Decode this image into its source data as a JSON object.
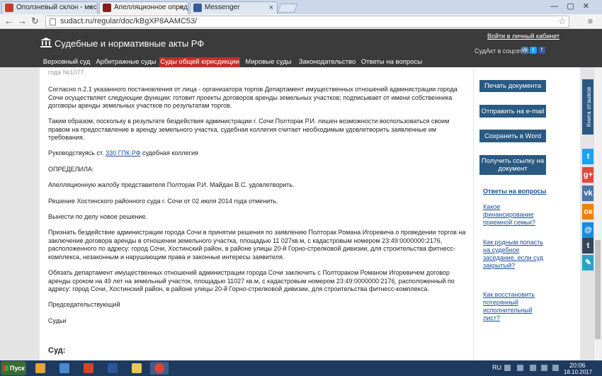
{
  "browser": {
    "tabs": [
      {
        "title": "Оползневый склон - мест",
        "color": "#cc3a2a"
      },
      {
        "title": "Апелляционное определе",
        "color": "#8a1e1e"
      },
      {
        "title": "Messenger",
        "color": "#3b5998"
      }
    ],
    "close_glyph": "×",
    "url": "sudact.ru/regular/doc/kBgXP8AAMC53/",
    "window_controls": "—▢✕"
  },
  "site": {
    "title": "Судебные и нормативные акты РФ",
    "login": "Войти в личный кабинет",
    "social_label": "СудАкт в соцсетях",
    "social": [
      {
        "icon": "vk-icon",
        "glyph": "vk",
        "color": "#4a76a8"
      },
      {
        "icon": "twitter-icon",
        "glyph": "t",
        "color": "#1da1f2"
      },
      {
        "icon": "facebook-icon",
        "glyph": "f",
        "color": "#3b5998"
      }
    ],
    "nav": [
      "Верховный суд",
      "Арбитражные суды",
      "Суды общей юрисдикции",
      "Мировые суды",
      "Законодательство",
      "Ответы на вопросы"
    ],
    "accent": "#c4302b"
  },
  "document": {
    "cut_top": "года №1077.",
    "p1": "Согласно п.2.1 указанного постановления от лица - организатора торгов Департамент имущественных отношений администрации города Сочи осуществляет следующие функции: готовит проекты договоров аренды земельных участков; подписывает от имени собственника договоры аренды земельных участков по результатам торгов.",
    "p2": "Таким образом, поскольку в результате бездействия администрации г. Сочи Полторак Р.И. лишен возможности воспользоваться своим правом на предоставление в аренду земельного участка, судебная коллегия считает необходимым удовлетворить заявленные им требования.",
    "p3_prefix": "Руководствуясь ст. ",
    "p3_link": "330 ГПК РФ",
    "p3_suffix": " судебная коллегия",
    "p4": "ОПРЕДЕЛИЛА:",
    "p5": "Апелляционную жалобу представителя Полторак Р.И. Майдан В.С. удовлетворить.",
    "p6": "Решение Хостинского районного суда г. Сочи от 02 июля 2014 года отменить.",
    "p7": "Вынести по делу новое решение.",
    "p8": "Признать бездействие администрации города Сочи в принятии решения по заявлению Полторак Романа Игоревича о проведении торгов на заключение договора аренды в отношении земельного участка, площадью 11 027кв.м, с кадастровым номером 23:49:0000000:2176, расположенного по адресу: город Сочи, Хостинский район, в районе улицы 20-й Горно-стрелковой дивизии, для строительства фитнесс-комплекса, незаконным и нарушающим права и законные интересы заявителя.",
    "p9": "Обязать департамент имущественных отношений администрации города Сочи заключить с Полтораком Романом Игоревичем договор аренды сроком на 49 лет на земельный участок, площадью 11027 кв.м, с кадастровым номером 23:49:0000000:2176, расположенный по адресу: город Сочи, Хостинский район, в районе улицы 20-й Горно-стрелковой дивизии, для строительства фитнесс-комплекса.",
    "p10": "Председательствующий",
    "p11": "Судьи",
    "judge_label": "Суд:"
  },
  "sidebar": {
    "print": "Печать документа",
    "email": "Отправить на e-mail",
    "word": "Сохранить в Word",
    "link": "Получить ссылку на документ",
    "qa_title": "Ответы на вопросы",
    "qa": [
      "Какое финансирование приемной семьи?",
      "Как родным попасть на судебное заседание, если суд закрытый?",
      "Как восстановить потерянный исполнительный лист?"
    ]
  },
  "right_strip": {
    "reviews": "Книга отзывов",
    "buttons": [
      {
        "icon": "twitter-icon",
        "glyph": "t",
        "color": "#1da1f2"
      },
      {
        "icon": "google-plus-icon",
        "glyph": "g+",
        "color": "#dd4b39"
      },
      {
        "icon": "vk-icon",
        "glyph": "vk",
        "color": "#4a76a8"
      },
      {
        "icon": "odnoklassniki-icon",
        "glyph": "ок",
        "color": "#ee8208"
      },
      {
        "icon": "moimir-icon",
        "glyph": "@",
        "color": "#168de2"
      },
      {
        "icon": "tumblr-icon",
        "glyph": "t",
        "color": "#35465c"
      },
      {
        "icon": "liveinternet-icon",
        "glyph": "✎",
        "color": "#2aa3c5"
      }
    ]
  },
  "taskbar": {
    "start": "Пуск",
    "lang": "RU",
    "time": "20:06",
    "date": "18.10.2017",
    "apps": [
      {
        "icon": "media-player-icon",
        "color": "#e8a33a"
      },
      {
        "icon": "network-icon",
        "color": "#4a8ad4"
      },
      {
        "icon": "presentation-icon",
        "color": "#d24726"
      },
      {
        "icon": "word-icon",
        "color": "#2b579a"
      },
      {
        "icon": "folder-icon",
        "color": "#e8c85a"
      },
      {
        "icon": "chrome-icon",
        "color": "#db4437"
      }
    ]
  }
}
